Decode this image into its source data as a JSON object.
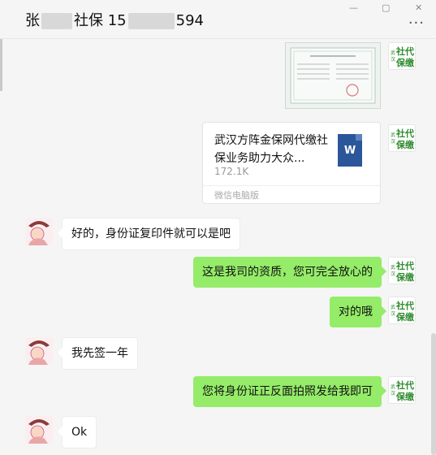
{
  "header": {
    "name_prefix": "张",
    "name_suffix": "社保 15",
    "phone_tail": "594",
    "more": "···"
  },
  "org_logo": {
    "top": "社代",
    "bottom": "保缴",
    "side": "武汉"
  },
  "file": {
    "name": "武汉方阵金保网代缴社保业务助力大众...",
    "size": "172.1K",
    "source": "微信电脑版",
    "icon_letter": "W"
  },
  "messages": {
    "m1": "好的，身份证复印件就可以是吧",
    "m2": "这是我司的资质，您可完全放心的",
    "m3": "对的哦",
    "m4": "我先签一年",
    "m5": "您将身份证正反面拍照发给我即可",
    "m6": "Ok"
  },
  "colors": {
    "sent_bubble": "#95ec69",
    "received_bubble": "#ffffff",
    "logo_green": "#2e8b2e"
  }
}
